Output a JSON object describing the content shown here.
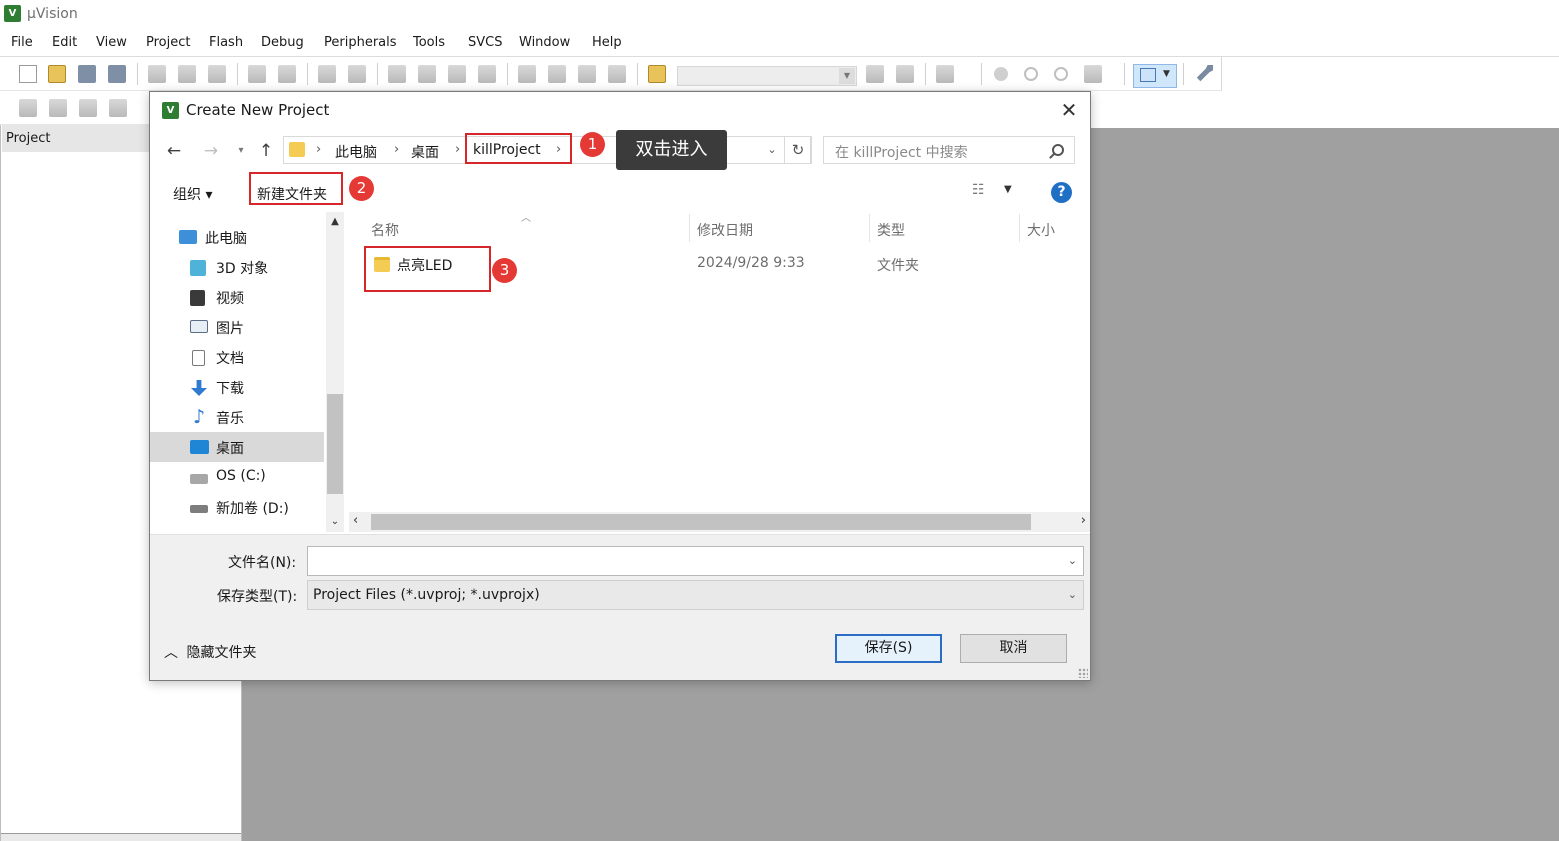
{
  "app": {
    "title": "µVision"
  },
  "menu": [
    "File",
    "Edit",
    "View",
    "Project",
    "Flash",
    "Debug",
    "Peripherals",
    "Tools",
    "SVCS",
    "Window",
    "Help"
  ],
  "project_panel": {
    "title": "Project"
  },
  "dialog": {
    "title": "Create New Project",
    "breadcrumb": [
      "此电脑",
      "桌面",
      "killProject"
    ],
    "search_placeholder": "在 killProject 中搜索",
    "organize_label": "组织 ▾",
    "new_folder_label": "新建文件夹",
    "nav_items": [
      {
        "label": "此电脑",
        "icon": "computer-icon"
      },
      {
        "label": "3D 对象",
        "icon": "cube-icon"
      },
      {
        "label": "视频",
        "icon": "video-icon"
      },
      {
        "label": "图片",
        "icon": "picture-icon"
      },
      {
        "label": "文档",
        "icon": "document-icon"
      },
      {
        "label": "下载",
        "icon": "download-icon"
      },
      {
        "label": "音乐",
        "icon": "music-icon"
      },
      {
        "label": "桌面",
        "icon": "desktop-icon",
        "selected": true
      },
      {
        "label": "OS (C:)",
        "icon": "drive-icon"
      },
      {
        "label": "新加卷 (D:)",
        "icon": "drive-icon"
      }
    ],
    "columns": [
      "名称",
      "修改日期",
      "类型",
      "大小"
    ],
    "files": [
      {
        "name": "点亮LED",
        "date": "2024/9/28 9:33",
        "type": "文件夹",
        "size": ""
      }
    ],
    "filename_label": "文件名(N):",
    "filename_value": "",
    "savetype_label": "保存类型(T):",
    "savetype_value": "Project Files (*.uvproj; *.uvprojx)",
    "hide_folders_label": "隐藏文件夹",
    "save_button": "保存(S)",
    "cancel_button": "取消"
  },
  "annotations": {
    "step1": "1",
    "step2": "2",
    "step3": "3",
    "tooltip": "双击进入"
  },
  "colors": {
    "highlight": "#d6262a",
    "badge": "#e53935",
    "accent": "#2b6cc4"
  }
}
